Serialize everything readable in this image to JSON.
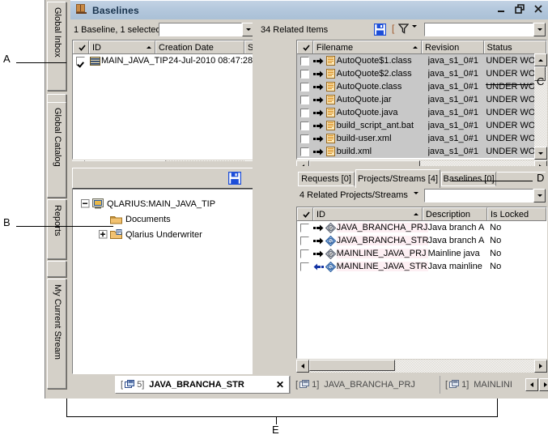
{
  "window": {
    "title": "Baselines",
    "icon": "book-icon",
    "buttons": {
      "minimize": "minimize-icon",
      "restore": "restore-icon",
      "close": "close-icon"
    }
  },
  "vertical_tabs": [
    {
      "label": "Global Inbox"
    },
    {
      "label": "Global Catalog"
    },
    {
      "label": "Reports"
    },
    {
      "label": "My Current Stream"
    }
  ],
  "baselines_pane": {
    "count_label": "1 Baseline, 1 selected",
    "combo_value": "",
    "columns": [
      {
        "label": ""
      },
      {
        "label": "ID",
        "sorted": "asc"
      },
      {
        "label": "Creation Date"
      },
      {
        "label": "S"
      }
    ],
    "rows": [
      {
        "checked": true,
        "icon": "baseline-icon",
        "id": "MAIN_JAVA_TIP",
        "creation_date": "24-Jul-2010 08:47:28"
      }
    ]
  },
  "related_items_pane": {
    "count_label": "34 Related Items",
    "save_icon": "save-icon",
    "filter_icon": "filter-icon",
    "filter_dropdown_icon": "chevron-down-icon",
    "combo_value": "",
    "columns": [
      {
        "label": ""
      },
      {
        "label": "Filename",
        "sorted": "asc"
      },
      {
        "label": "Revision"
      },
      {
        "label": "Status"
      }
    ],
    "rows": [
      {
        "checked": false,
        "arrow": "arrow-right-icon",
        "icon": "file-icon",
        "filename": "AutoQuote$1.class",
        "revision": "java_s1_0#1",
        "status": "UNDER WO"
      },
      {
        "checked": false,
        "arrow": "arrow-right-icon",
        "icon": "file-icon",
        "filename": "AutoQuote$2.class",
        "revision": "java_s1_0#1",
        "status": "UNDER WO"
      },
      {
        "checked": false,
        "arrow": "arrow-right-icon",
        "icon": "file-icon",
        "filename": "AutoQuote.class",
        "revision": "java_s1_0#1",
        "status": "UNDER WO"
      },
      {
        "checked": false,
        "arrow": "arrow-right-icon",
        "icon": "file-icon",
        "filename": "AutoQuote.jar",
        "revision": "java_s1_0#1",
        "status": "UNDER WO"
      },
      {
        "checked": false,
        "arrow": "arrow-right-icon",
        "icon": "file-icon",
        "filename": "AutoQuote.java",
        "revision": "java_s1_0#1",
        "status": "UNDER WO"
      },
      {
        "checked": false,
        "arrow": "arrow-right-icon",
        "icon": "file-icon",
        "filename": "build_script_ant.bat",
        "revision": "java_s1_0#1",
        "status": "UNDER WO"
      },
      {
        "checked": false,
        "arrow": "arrow-right-icon",
        "icon": "file-icon",
        "filename": "build-user.xml",
        "revision": "java_s1_0#1",
        "status": "UNDER WO"
      },
      {
        "checked": false,
        "arrow": "arrow-right-icon",
        "icon": "file-icon",
        "filename": "build.xml",
        "revision": "java_s1_0#1",
        "status": "UNDER WO"
      }
    ]
  },
  "tree_pane": {
    "save_icon": "save-icon",
    "nodes": [
      {
        "level": 0,
        "expander": "minus",
        "icon": "stream-icon",
        "label": "QLARIUS:MAIN_JAVA_TIP"
      },
      {
        "level": 1,
        "expander": "none",
        "icon": "folder-icon",
        "label": "Documents"
      },
      {
        "level": 1,
        "expander": "plus",
        "icon": "project-folder-icon",
        "label": "Qlarius Underwriter"
      }
    ]
  },
  "detail_tabs": [
    {
      "label": "Requests [0]",
      "selected": false
    },
    {
      "label": "Projects/Streams [4]",
      "selected": true
    },
    {
      "label": "Baselines [0]",
      "selected": false
    }
  ],
  "projects_pane": {
    "count_label": "4 Related Projects/Streams",
    "count_dropdown_icon": "chevron-down-icon",
    "combo_value": "",
    "columns": [
      {
        "label": ""
      },
      {
        "label": "ID",
        "sorted": "asc"
      },
      {
        "label": "Description"
      },
      {
        "label": "Is Locked"
      }
    ],
    "rows": [
      {
        "checked": false,
        "arrow": "arrow-right-icon",
        "icon": "project-icon",
        "id": "JAVA_BRANCHA_PRJ",
        "description": "Java branch A",
        "is_locked": "No"
      },
      {
        "checked": false,
        "arrow": "arrow-right-icon",
        "icon": "stream-diamond-icon",
        "id": "JAVA_BRANCHA_STR",
        "description": "Java branch A",
        "is_locked": "No"
      },
      {
        "checked": false,
        "arrow": "arrow-right-icon",
        "icon": "project-icon",
        "id": "MAINLINE_JAVA_PRJ",
        "description": "Mainline java",
        "is_locked": "No"
      },
      {
        "checked": false,
        "arrow": "arrow-left-icon",
        "icon": "stream-diamond-icon",
        "id": "MAINLINE_JAVA_STR",
        "description": "Java mainline",
        "is_locked": "No"
      }
    ]
  },
  "document_tabs": [
    {
      "count": "5",
      "label": "JAVA_BRANCHA_STR",
      "active": true,
      "close_icon": "close-icon"
    },
    {
      "count": "1",
      "label": "JAVA_BRANCHA_PRJ",
      "active": false
    },
    {
      "count": "1",
      "label": "MAINLINI",
      "active": false
    }
  ],
  "doc_tab_nav": {
    "prev_icon": "arrow-left-icon",
    "next_icon": "arrow-right-icon"
  },
  "callouts": [
    {
      "letter": "A"
    },
    {
      "letter": "B"
    },
    {
      "letter": "C"
    },
    {
      "letter": "D"
    },
    {
      "letter": "E"
    }
  ],
  "colors": {
    "titlebar": "#b4c8dd",
    "chrome": "#d4d0c8",
    "selection_grey": "#c8c8c8",
    "selection_pink": "#fdeff3",
    "accent_blue": "#2255cc",
    "folder_orange": "#e8a33d"
  }
}
